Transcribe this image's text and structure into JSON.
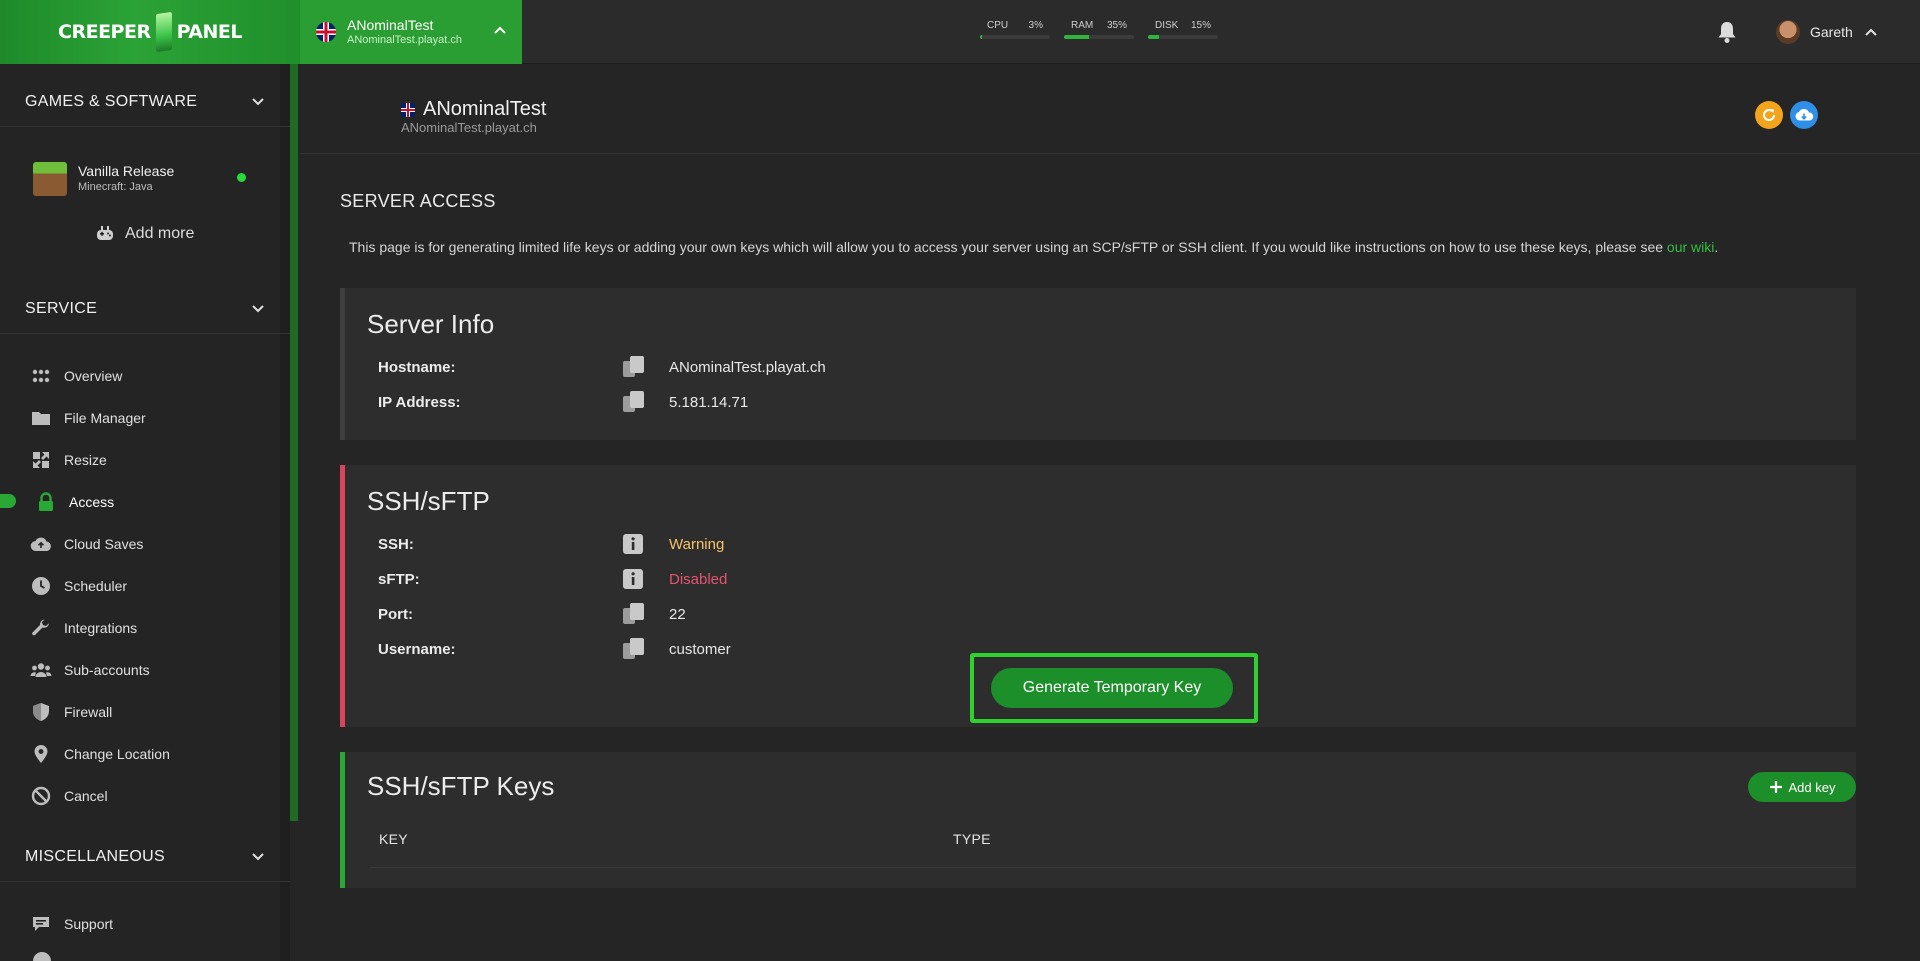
{
  "brand": {
    "logo_left": "CREEPER",
    "logo_right": "PANEL"
  },
  "topbar": {
    "server_name": "ANominalTest",
    "server_host": "ANominalTest.playat.ch",
    "stats": [
      {
        "label": "CPU",
        "value": "3%",
        "percent": 3
      },
      {
        "label": "RAM",
        "value": "35%",
        "percent": 35
      },
      {
        "label": "DISK",
        "value": "15%",
        "percent": 15
      }
    ],
    "user_name": "Gareth"
  },
  "sidebar": {
    "games_heading": "GAMES & SOFTWARE",
    "game": {
      "title": "Vanilla Release",
      "subtitle": "Minecraft: Java",
      "status_color": "#28d93a"
    },
    "add_more": "Add more",
    "service_heading": "SERVICE",
    "items": [
      {
        "label": "Overview",
        "icon": "grid-icon"
      },
      {
        "label": "File Manager",
        "icon": "folder-icon"
      },
      {
        "label": "Resize",
        "icon": "resize-icon"
      },
      {
        "label": "Access",
        "icon": "lock-icon"
      },
      {
        "label": "Cloud Saves",
        "icon": "cloud-icon"
      },
      {
        "label": "Scheduler",
        "icon": "clock-icon"
      },
      {
        "label": "Integrations",
        "icon": "wrench-icon"
      },
      {
        "label": "Sub-accounts",
        "icon": "users-icon"
      },
      {
        "label": "Firewall",
        "icon": "shield-icon"
      },
      {
        "label": "Change Location",
        "icon": "pin-icon"
      },
      {
        "label": "Cancel",
        "icon": "cancel-icon"
      }
    ],
    "active_item": "Access",
    "misc_heading": "MISCELLANEOUS",
    "misc_items": [
      {
        "label": "Support",
        "icon": "chat-icon"
      }
    ]
  },
  "page": {
    "title": "ANominalTest",
    "host": "ANominalTest.playat.ch",
    "section_title": "SERVER ACCESS",
    "intro": "This page is for generating limited life keys or adding your own keys which will allow you to access your server using an SCP/sFTP or SSH client. If you would like instructions on how to use these keys, please see ",
    "intro_link": "our wiki",
    "intro_end": "."
  },
  "server_info": {
    "title": "Server Info",
    "hostname_label": "Hostname:",
    "hostname": "ANominalTest.playat.ch",
    "ip_label": "IP Address:",
    "ip": "5.181.14.71"
  },
  "ssh": {
    "title": "SSH/sFTP",
    "ssh_label": "SSH:",
    "ssh_value": "Warning",
    "sftp_label": "sFTP:",
    "sftp_value": "Disabled",
    "port_label": "Port:",
    "port": "22",
    "username_label": "Username:",
    "username": "customer",
    "generate_button": "Generate Temporary Key"
  },
  "keys": {
    "title": "SSH/sFTP Keys",
    "add_button": "Add key",
    "columns": [
      "KEY",
      "TYPE"
    ]
  },
  "colors": {
    "accent": "#2aa836",
    "warning": "#f6c36a",
    "disabled": "#e55472"
  }
}
